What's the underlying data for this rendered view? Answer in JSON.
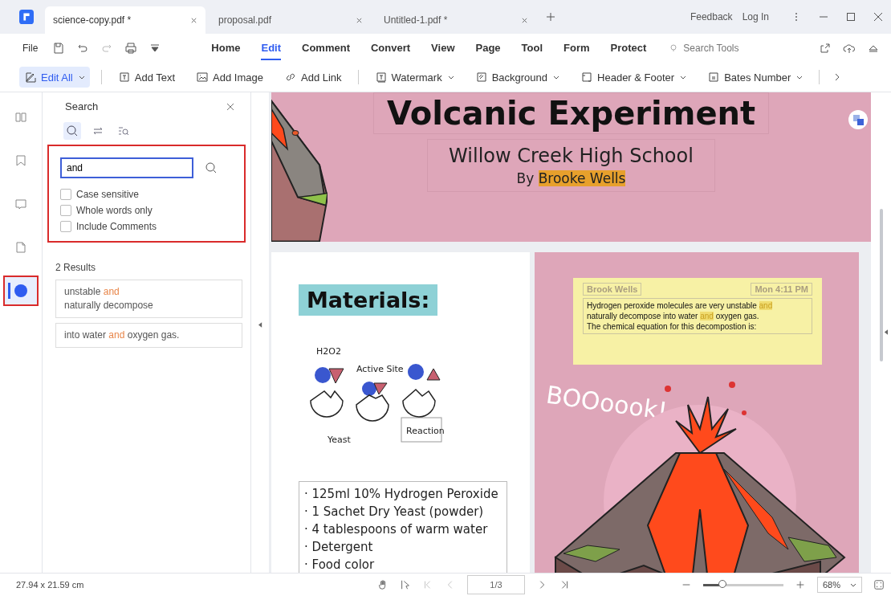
{
  "tabs": [
    {
      "label": "science-copy.pdf *",
      "selected": true
    },
    {
      "label": "proposal.pdf",
      "selected": false
    },
    {
      "label": "Untitled-1.pdf *",
      "selected": false
    }
  ],
  "title_links": [
    "Feedback",
    "Log In"
  ],
  "menu": {
    "file": "File",
    "items": [
      {
        "label": "Home",
        "selected": false
      },
      {
        "label": "Edit",
        "selected": true
      },
      {
        "label": "Comment",
        "selected": false
      },
      {
        "label": "Convert",
        "selected": false
      },
      {
        "label": "View",
        "selected": false
      },
      {
        "label": "Page",
        "selected": false
      },
      {
        "label": "Tool",
        "selected": false
      },
      {
        "label": "Form",
        "selected": false
      },
      {
        "label": "Protect",
        "selected": false
      }
    ],
    "search_placeholder": "Search Tools"
  },
  "toolbar": [
    {
      "label": "Edit All",
      "dropdown": true,
      "selected": true
    },
    {
      "label": "Add Text",
      "dropdown": false,
      "selected": false
    },
    {
      "label": "Add Image",
      "dropdown": false,
      "selected": false
    },
    {
      "label": "Add Link",
      "dropdown": false,
      "selected": false
    },
    {
      "label": "Watermark",
      "dropdown": true,
      "selected": false
    },
    {
      "label": "Background",
      "dropdown": true,
      "selected": false
    },
    {
      "label": "Header & Footer",
      "dropdown": true,
      "selected": false
    },
    {
      "label": "Bates Number",
      "dropdown": true,
      "selected": false
    }
  ],
  "sidebar": {
    "items": [
      {
        "selected": false,
        "highlighted": false
      },
      {
        "selected": false,
        "highlighted": false
      },
      {
        "selected": false,
        "highlighted": false
      },
      {
        "selected": false,
        "highlighted": false
      },
      {
        "selected": true,
        "highlighted": true
      }
    ]
  },
  "search_panel": {
    "title": "Search",
    "modes": [
      {
        "selected": true
      },
      {
        "selected": false
      },
      {
        "selected": false
      }
    ],
    "query": "and",
    "highlighted": true,
    "options": [
      {
        "label": "Case sensitive",
        "checked": false
      },
      {
        "label": "Whole words only",
        "checked": false
      },
      {
        "label": "Include Comments",
        "checked": false
      }
    ],
    "results_count": "2 Results",
    "results": [
      {
        "lines": [
          [
            {
              "text": "unstable ",
              "match": false
            },
            {
              "text": "and",
              "match": true
            }
          ],
          [
            {
              "text": "naturally decompose",
              "match": false
            }
          ]
        ]
      },
      {
        "lines": [
          [
            {
              "text": "into water ",
              "match": false
            },
            {
              "text": "and",
              "match": true
            },
            {
              "text": " oxygen gas.",
              "match": false
            }
          ]
        ]
      }
    ]
  },
  "document": {
    "title": "Volcanic Experiment",
    "school": "Willow Creek High School",
    "byline": [
      {
        "text": "By ",
        "highlight": false
      },
      {
        "text": "Brooke Wells",
        "highlight": true
      }
    ],
    "materials_heading": "Materials:",
    "diagram_labels": [
      "H2O2",
      "Active Site",
      "Yeast",
      "Reaction"
    ],
    "materials": [
      "· 125ml 10% Hydrogen Peroxide",
      "· 1 Sachet Dry Yeast (powder)",
      "· 4 tablespoons of warm water",
      "· Detergent",
      "· Food color"
    ],
    "note": {
      "author": "Brook Wells",
      "time": "Mon 4:11 PM",
      "lines": [
        [
          {
            "text": "Hydrogen peroxide molecules are very unstable ",
            "highlight": false
          },
          {
            "text": "and",
            "highlight": true
          }
        ],
        [
          {
            "text": "naturally decompose into water ",
            "highlight": false
          },
          {
            "text": "and",
            "highlight": true
          },
          {
            "text": " oxygen gas.",
            "highlight": false
          }
        ],
        [
          {
            "text": "The chemical equation for this decompostion is:",
            "highlight": false
          }
        ]
      ]
    },
    "exclamation": "BOOoook!"
  },
  "status_bar": {
    "page_size": "27.94 x 21.59 cm",
    "page": "1/3",
    "zoom_slider": {
      "level": 0.25
    },
    "zoom": "68%"
  }
}
